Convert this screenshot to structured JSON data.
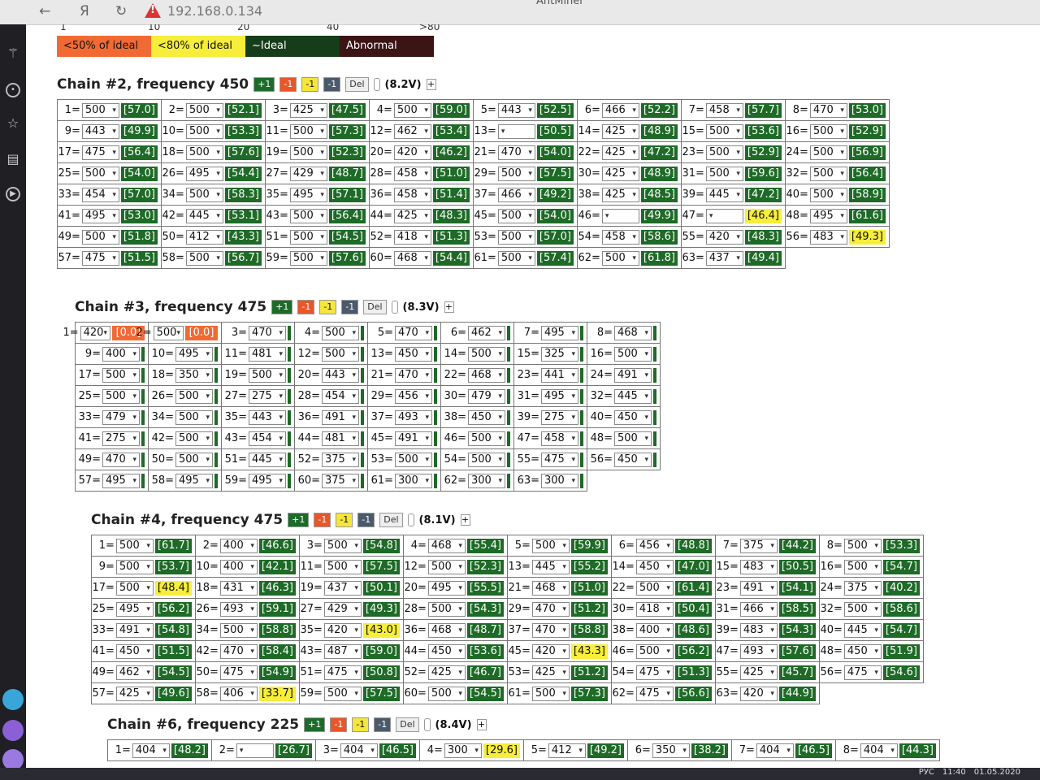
{
  "browser": {
    "url": "192.168.0.134",
    "title": "AntMiner",
    "warning": "!"
  },
  "scale": [
    "1",
    "10",
    "20",
    "40",
    ">80"
  ],
  "legend": [
    "<50% of ideal",
    "<80% of ideal",
    "~Ideal",
    "Abnormal"
  ],
  "chains": [
    {
      "title": "Chain #2, frequency 450",
      "volt": "(8.2V)",
      "btn_plus": "+1",
      "btn_red": "-1",
      "btn_yel": "-1",
      "btn_gray": "-1",
      "btn_del": "Del",
      "btn_add": "+",
      "cells": [
        [
          "1=",
          "500",
          "57.0",
          "g"
        ],
        [
          "9=",
          "443",
          "49.9",
          "g"
        ],
        [
          "17=",
          "475",
          "56.4",
          "g"
        ],
        [
          "25=",
          "500",
          "54.0",
          "g"
        ],
        [
          "33=",
          "454",
          "57.0",
          "g"
        ],
        [
          "41=",
          "495",
          "53.0",
          "g"
        ],
        [
          "49=",
          "500",
          "51.8",
          "g"
        ],
        [
          "57=",
          "475",
          "51.5",
          "g"
        ],
        [
          "2=",
          "500",
          "52.1",
          "g"
        ],
        [
          "10=",
          "500",
          "53.3",
          "g"
        ],
        [
          "18=",
          "500",
          "57.6",
          "g"
        ],
        [
          "26=",
          "495",
          "54.4",
          "g"
        ],
        [
          "34=",
          "500",
          "58.3",
          "g"
        ],
        [
          "42=",
          "445",
          "53.1",
          "g"
        ],
        [
          "50=",
          "412",
          "43.3",
          "g"
        ],
        [
          "58=",
          "500",
          "56.7",
          "g"
        ],
        [
          "3=",
          "425",
          "47.5",
          "g"
        ],
        [
          "11=",
          "500",
          "57.3",
          "g"
        ],
        [
          "19=",
          "500",
          "52.3",
          "g"
        ],
        [
          "27=",
          "429",
          "48.7",
          "g"
        ],
        [
          "35=",
          "495",
          "57.1",
          "g"
        ],
        [
          "43=",
          "500",
          "56.4",
          "g"
        ],
        [
          "51=",
          "500",
          "54.5",
          "g"
        ],
        [
          "59=",
          "500",
          "57.6",
          "g"
        ],
        [
          "4=",
          "500",
          "59.0",
          "g"
        ],
        [
          "12=",
          "462",
          "53.4",
          "g"
        ],
        [
          "20=",
          "420",
          "46.2",
          "g"
        ],
        [
          "28=",
          "458",
          "51.0",
          "g"
        ],
        [
          "36=",
          "458",
          "51.4",
          "g"
        ],
        [
          "44=",
          "425",
          "48.3",
          "g"
        ],
        [
          "52=",
          "418",
          "51.3",
          "g"
        ],
        [
          "60=",
          "468",
          "54.4",
          "g"
        ],
        [
          "5=",
          "443",
          "52.5",
          "g"
        ],
        [
          "13=",
          "",
          "50.5",
          "g"
        ],
        [
          "21=",
          "470",
          "54.0",
          "g"
        ],
        [
          "29=",
          "500",
          "57.5",
          "g"
        ],
        [
          "37=",
          "466",
          "49.2",
          "g"
        ],
        [
          "45=",
          "500",
          "54.0",
          "g"
        ],
        [
          "53=",
          "500",
          "57.0",
          "g"
        ],
        [
          "61=",
          "500",
          "57.4",
          "g"
        ],
        [
          "6=",
          "466",
          "52.2",
          "g"
        ],
        [
          "14=",
          "425",
          "48.9",
          "g"
        ],
        [
          "22=",
          "425",
          "47.2",
          "g"
        ],
        [
          "30=",
          "425",
          "48.9",
          "g"
        ],
        [
          "38=",
          "425",
          "48.5",
          "g"
        ],
        [
          "46=",
          "",
          "49.9",
          "g"
        ],
        [
          "54=",
          "458",
          "58.6",
          "g"
        ],
        [
          "62=",
          "500",
          "61.8",
          "g"
        ],
        [
          "7=",
          "458",
          "57.7",
          "g"
        ],
        [
          "15=",
          "500",
          "53.6",
          "g"
        ],
        [
          "23=",
          "500",
          "52.9",
          "g"
        ],
        [
          "31=",
          "500",
          "59.6",
          "g"
        ],
        [
          "39=",
          "445",
          "47.2",
          "g"
        ],
        [
          "47=",
          "",
          "46.4",
          "y"
        ],
        [
          "55=",
          "420",
          "48.3",
          "g"
        ],
        [
          "63=",
          "437",
          "49.4",
          "g"
        ],
        [
          "8=",
          "470",
          "53.0",
          "g"
        ],
        [
          "16=",
          "500",
          "52.9",
          "g"
        ],
        [
          "24=",
          "500",
          "56.9",
          "g"
        ],
        [
          "32=",
          "500",
          "56.4",
          "g"
        ],
        [
          "40=",
          "500",
          "58.9",
          "g"
        ],
        [
          "48=",
          "495",
          "61.6",
          "g"
        ],
        [
          "56=",
          "483",
          "49.3",
          "y"
        ]
      ]
    },
    {
      "title": "Chain #3, frequency 475",
      "volt": "(8.3V)",
      "btn_plus": "+1",
      "btn_red": "-1",
      "btn_yel": "-1",
      "btn_gray": "-1",
      "btn_del": "Del",
      "btn_add": "+",
      "cells": [
        [
          "1=",
          "420",
          "0.0",
          "r"
        ],
        [
          "9=",
          "400",
          "",
          "b"
        ],
        [
          "17=",
          "500",
          "",
          "b"
        ],
        [
          "25=",
          "500",
          "",
          "b"
        ],
        [
          "33=",
          "479",
          "",
          "b"
        ],
        [
          "41=",
          "275",
          "",
          "b"
        ],
        [
          "49=",
          "470",
          "",
          "b"
        ],
        [
          "57=",
          "495",
          "",
          "b"
        ],
        [
          "2=",
          "500",
          "0.0",
          "r"
        ],
        [
          "10=",
          "495",
          "",
          "b"
        ],
        [
          "18=",
          "350",
          "",
          "b"
        ],
        [
          "26=",
          "500",
          "",
          "b"
        ],
        [
          "34=",
          "500",
          "",
          "b"
        ],
        [
          "42=",
          "500",
          "",
          "b"
        ],
        [
          "50=",
          "500",
          "",
          "b"
        ],
        [
          "58=",
          "495",
          "",
          "b"
        ],
        [
          "3=",
          "470",
          "",
          "b"
        ],
        [
          "11=",
          "481",
          "",
          "b"
        ],
        [
          "19=",
          "500",
          "",
          "b"
        ],
        [
          "27=",
          "275",
          "",
          "b"
        ],
        [
          "35=",
          "443",
          "",
          "b"
        ],
        [
          "43=",
          "454",
          "",
          "b"
        ],
        [
          "51=",
          "445",
          "",
          "b"
        ],
        [
          "59=",
          "495",
          "",
          "b"
        ],
        [
          "4=",
          "500",
          "",
          "b"
        ],
        [
          "12=",
          "500",
          "",
          "b"
        ],
        [
          "20=",
          "443",
          "",
          "b"
        ],
        [
          "28=",
          "454",
          "",
          "b"
        ],
        [
          "36=",
          "491",
          "",
          "b"
        ],
        [
          "44=",
          "481",
          "",
          "b"
        ],
        [
          "52=",
          "375",
          "",
          "b"
        ],
        [
          "60=",
          "375",
          "",
          "b"
        ],
        [
          "5=",
          "470",
          "",
          "b"
        ],
        [
          "13=",
          "450",
          "",
          "b"
        ],
        [
          "21=",
          "470",
          "",
          "b"
        ],
        [
          "29=",
          "456",
          "",
          "b"
        ],
        [
          "37=",
          "493",
          "",
          "b"
        ],
        [
          "45=",
          "491",
          "",
          "b"
        ],
        [
          "53=",
          "500",
          "",
          "b"
        ],
        [
          "61=",
          "300",
          "",
          "b"
        ],
        [
          "6=",
          "462",
          "",
          "b"
        ],
        [
          "14=",
          "500",
          "",
          "b"
        ],
        [
          "22=",
          "468",
          "",
          "b"
        ],
        [
          "30=",
          "479",
          "",
          "b"
        ],
        [
          "38=",
          "450",
          "",
          "b"
        ],
        [
          "46=",
          "500",
          "",
          "b"
        ],
        [
          "54=",
          "500",
          "",
          "b"
        ],
        [
          "62=",
          "300",
          "",
          "b"
        ],
        [
          "7=",
          "495",
          "",
          "b"
        ],
        [
          "15=",
          "325",
          "",
          "b"
        ],
        [
          "23=",
          "441",
          "",
          "b"
        ],
        [
          "31=",
          "495",
          "",
          "b"
        ],
        [
          "39=",
          "275",
          "",
          "b"
        ],
        [
          "47=",
          "458",
          "",
          "b"
        ],
        [
          "55=",
          "475",
          "",
          "b"
        ],
        [
          "63=",
          "300",
          "",
          "b"
        ],
        [
          "8=",
          "468",
          "",
          "b"
        ],
        [
          "16=",
          "500",
          "",
          "b"
        ],
        [
          "24=",
          "491",
          "",
          "b"
        ],
        [
          "32=",
          "445",
          "",
          "b"
        ],
        [
          "40=",
          "450",
          "",
          "b"
        ],
        [
          "48=",
          "500",
          "",
          "b"
        ],
        [
          "56=",
          "450",
          "",
          "b"
        ]
      ]
    },
    {
      "title": "Chain #4, frequency 475",
      "volt": "(8.1V)",
      "btn_plus": "+1",
      "btn_red": "-1",
      "btn_yel": "-1",
      "btn_gray": "-1",
      "btn_del": "Del",
      "btn_add": "+",
      "cells": [
        [
          "1=",
          "500",
          "61.7",
          "g"
        ],
        [
          "9=",
          "500",
          "53.7",
          "g"
        ],
        [
          "17=",
          "500",
          "48.4",
          "y"
        ],
        [
          "25=",
          "495",
          "56.2",
          "g"
        ],
        [
          "33=",
          "491",
          "54.8",
          "g"
        ],
        [
          "41=",
          "450",
          "51.5",
          "g"
        ],
        [
          "49=",
          "462",
          "54.5",
          "g"
        ],
        [
          "57=",
          "425",
          "49.6",
          "g"
        ],
        [
          "2=",
          "400",
          "46.6",
          "g"
        ],
        [
          "10=",
          "400",
          "42.1",
          "g"
        ],
        [
          "18=",
          "431",
          "46.3",
          "g"
        ],
        [
          "26=",
          "493",
          "59.1",
          "g"
        ],
        [
          "34=",
          "500",
          "58.8",
          "g"
        ],
        [
          "42=",
          "470",
          "58.4",
          "g"
        ],
        [
          "50=",
          "475",
          "54.9",
          "g"
        ],
        [
          "58=",
          "406",
          "33.7",
          "y"
        ],
        [
          "3=",
          "500",
          "54.8",
          "g"
        ],
        [
          "11=",
          "500",
          "57.5",
          "g"
        ],
        [
          "19=",
          "437",
          "50.1",
          "g"
        ],
        [
          "27=",
          "429",
          "49.3",
          "g"
        ],
        [
          "35=",
          "420",
          "43.0",
          "y"
        ],
        [
          "43=",
          "487",
          "59.0",
          "g"
        ],
        [
          "51=",
          "475",
          "50.8",
          "g"
        ],
        [
          "59=",
          "500",
          "57.5",
          "g"
        ],
        [
          "4=",
          "468",
          "55.4",
          "g"
        ],
        [
          "12=",
          "500",
          "52.3",
          "g"
        ],
        [
          "20=",
          "495",
          "55.5",
          "g"
        ],
        [
          "28=",
          "500",
          "54.3",
          "g"
        ],
        [
          "36=",
          "468",
          "48.7",
          "g"
        ],
        [
          "44=",
          "450",
          "53.6",
          "g"
        ],
        [
          "52=",
          "425",
          "46.7",
          "g"
        ],
        [
          "60=",
          "500",
          "54.5",
          "g"
        ],
        [
          "5=",
          "500",
          "59.9",
          "g"
        ],
        [
          "13=",
          "445",
          "55.2",
          "g"
        ],
        [
          "21=",
          "468",
          "51.0",
          "g"
        ],
        [
          "29=",
          "470",
          "51.2",
          "g"
        ],
        [
          "37=",
          "470",
          "58.8",
          "g"
        ],
        [
          "45=",
          "420",
          "43.3",
          "y"
        ],
        [
          "53=",
          "425",
          "51.2",
          "g"
        ],
        [
          "61=",
          "500",
          "57.3",
          "g"
        ],
        [
          "6=",
          "456",
          "48.8",
          "g"
        ],
        [
          "14=",
          "450",
          "47.0",
          "g"
        ],
        [
          "22=",
          "500",
          "61.4",
          "g"
        ],
        [
          "30=",
          "418",
          "50.4",
          "g"
        ],
        [
          "38=",
          "400",
          "48.6",
          "g"
        ],
        [
          "46=",
          "500",
          "56.2",
          "g"
        ],
        [
          "54=",
          "475",
          "51.3",
          "g"
        ],
        [
          "62=",
          "475",
          "56.6",
          "g"
        ],
        [
          "7=",
          "375",
          "44.2",
          "g"
        ],
        [
          "15=",
          "483",
          "50.5",
          "g"
        ],
        [
          "23=",
          "491",
          "54.1",
          "g"
        ],
        [
          "31=",
          "466",
          "58.5",
          "g"
        ],
        [
          "39=",
          "483",
          "54.3",
          "g"
        ],
        [
          "47=",
          "493",
          "57.6",
          "g"
        ],
        [
          "55=",
          "425",
          "45.7",
          "g"
        ],
        [
          "63=",
          "420",
          "44.9",
          "g"
        ],
        [
          "8=",
          "500",
          "53.3",
          "g"
        ],
        [
          "16=",
          "500",
          "54.7",
          "g"
        ],
        [
          "24=",
          "375",
          "40.2",
          "g"
        ],
        [
          "32=",
          "500",
          "58.6",
          "g"
        ],
        [
          "40=",
          "445",
          "54.7",
          "g"
        ],
        [
          "48=",
          "450",
          "51.9",
          "g"
        ],
        [
          "56=",
          "475",
          "54.6",
          "g"
        ]
      ]
    },
    {
      "title": "Chain #6, frequency 225",
      "volt": "(8.4V)",
      "btn_plus": "+1",
      "btn_red": "-1",
      "btn_yel": "-1",
      "btn_gray": "-1",
      "btn_del": "Del",
      "btn_add": "+",
      "cells": [
        [
          "1=",
          "404",
          "48.2",
          "g"
        ],
        [
          "2=",
          "",
          "26.7",
          "g"
        ],
        [
          "3=",
          "404",
          "46.5",
          "g"
        ],
        [
          "4=",
          "300",
          "29.6",
          "y"
        ],
        [
          "5=",
          "412",
          "49.2",
          "g"
        ],
        [
          "6=",
          "350",
          "38.2",
          "g"
        ],
        [
          "7=",
          "404",
          "46.5",
          "g"
        ],
        [
          "8=",
          "404",
          "44.3",
          "g"
        ]
      ]
    }
  ],
  "tray": {
    "lang": "РУС",
    "time": "11:40",
    "date": "01.05.2020"
  }
}
